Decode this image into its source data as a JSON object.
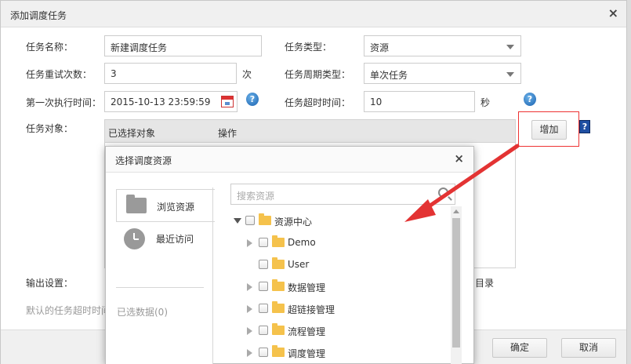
{
  "dialog": {
    "title": "添加调度任务",
    "close_glyph": "×",
    "ok_label": "确定",
    "cancel_label": "取消"
  },
  "form": {
    "task_name_label": "任务名称：",
    "task_name_value": "新建调度任务",
    "task_type_label": "任务类型：",
    "task_type_value": "资源",
    "retry_label": "任务重试次数：",
    "retry_value": "3",
    "retry_unit": "次",
    "cycle_label": "任务周期类型：",
    "cycle_value": "单次任务",
    "first_run_label": "第一次执行时间：",
    "first_run_value": "2015-10-13 23:59:59",
    "timeout_label": "任务超时时间：",
    "timeout_value": "10",
    "timeout_unit": "秒",
    "object_label": "任务对象：",
    "grid_col_selected": "已选择对象",
    "grid_col_action": "操作",
    "add_button": "增加",
    "help_book_glyph": "?",
    "output_label": "输出设置：",
    "output_partial_right": "目录",
    "note_partial": "默认的任务超时时间"
  },
  "modal": {
    "title": "选择调度资源",
    "close_glyph": "×",
    "nav": [
      {
        "label": "浏览资源",
        "icon": "folder-icon",
        "active": true
      },
      {
        "label": "最近访问",
        "icon": "clock-icon",
        "active": false
      }
    ],
    "selected_count": "已选数据(0)",
    "search_placeholder": "搜索资源",
    "tree": [
      {
        "label": "资源中心",
        "expand": "open"
      },
      {
        "label": "Demo",
        "expand": "closed"
      },
      {
        "label": "User",
        "expand": "none"
      },
      {
        "label": "数据管理",
        "expand": "closed"
      },
      {
        "label": "超链接管理",
        "expand": "closed"
      },
      {
        "label": "流程管理",
        "expand": "closed"
      },
      {
        "label": "调度管理",
        "expand": "closed"
      }
    ]
  },
  "colors": {
    "highlight_red": "#e33333",
    "folder_yellow": "#f5c24c",
    "help_blue": "#1a62b0"
  }
}
